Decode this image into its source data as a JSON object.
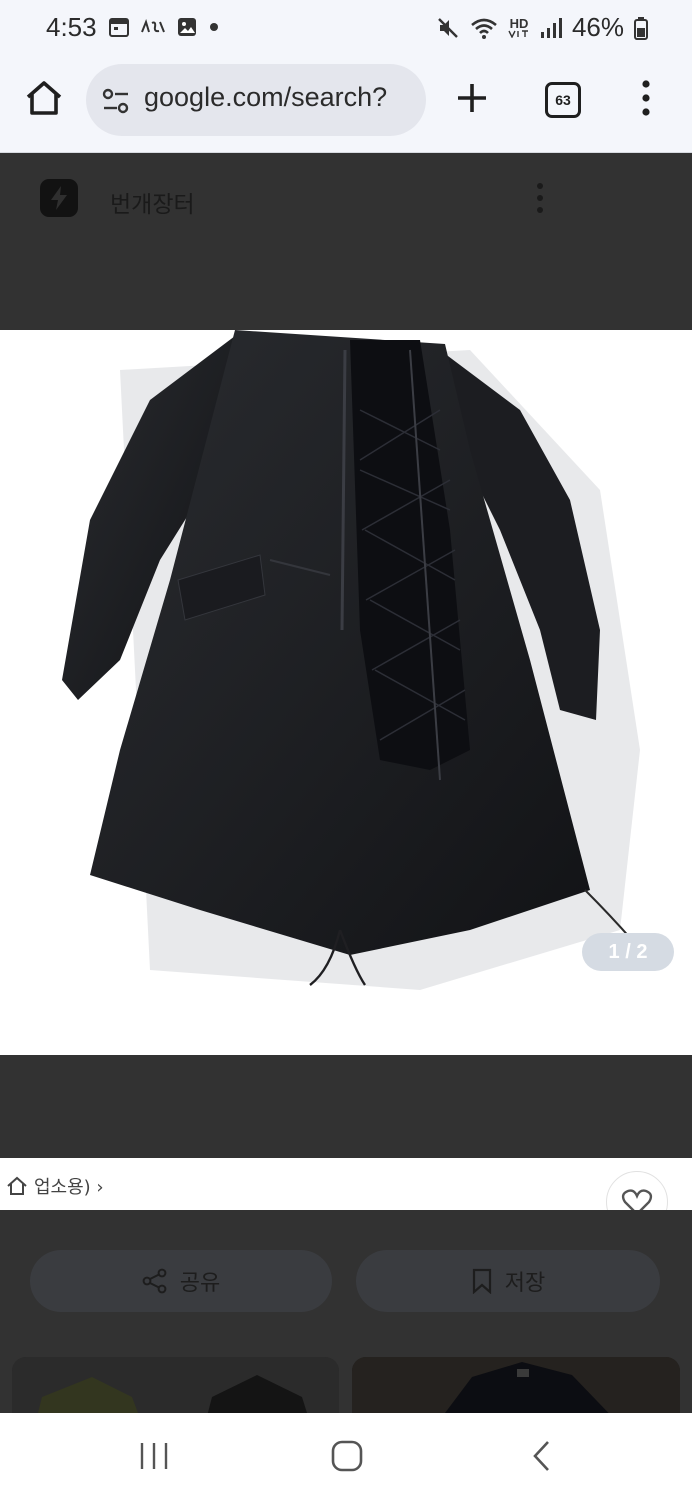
{
  "status_bar": {
    "time": "4:53",
    "left_icons": [
      "calendar-icon",
      "app-logo-icon",
      "gallery-icon",
      "dot-icon"
    ],
    "right_icons": [
      "mute-icon",
      "wifi-icon",
      "hd-voice-icon",
      "signal-icon",
      "battery-icon"
    ],
    "hd_voice_label": "HD",
    "battery_percent": "46%"
  },
  "browser": {
    "url": "google.com/search?",
    "tab_count": "63"
  },
  "site": {
    "name": "번개장터"
  },
  "product": {
    "image_counter": "1 / 2",
    "breadcrumb": "업소용) ›"
  },
  "actions": {
    "share_label": "공유",
    "save_label": "저장"
  },
  "colors": {
    "dim_overlay": "#323232",
    "toolbar_bg": "#f4f6fb",
    "omnibox_bg": "#e4e6ed"
  }
}
